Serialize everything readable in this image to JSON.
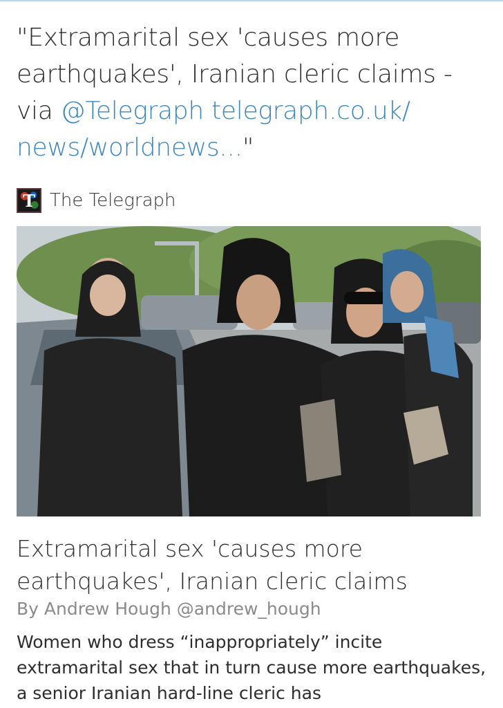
{
  "tweet": {
    "text_before": "\"Extramarital sex 'causes more earthquakes', Iranian cleric claims - via ",
    "mention": "@Telegraph",
    "space": " ",
    "link": "telegraph.co.uk/ news/worldnews...",
    "text_after": "\"",
    "link_color": "#3b86bd"
  },
  "card": {
    "source_logo_letter": "T",
    "source_name": "The Telegraph",
    "photo_icon": "news-photo",
    "headline": "Extramarital sex 'causes more earthquakes', Iranian cleric claims",
    "byline": "By Andrew Hough @andrew_hough",
    "summary": "Women who dress “inappropriately” incite extramarital sex that in turn cause more earthquakes, a senior Iranian hard-line cleric has"
  }
}
